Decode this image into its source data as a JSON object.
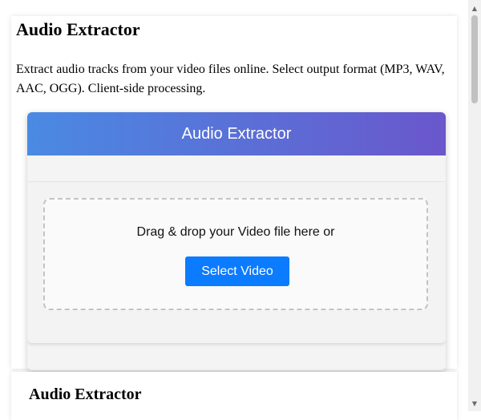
{
  "page": {
    "title": "Audio Extractor",
    "description": "Extract audio tracks from your video files online. Select output format (MP3, WAV, AAC, OGG). Client-side processing."
  },
  "tool": {
    "header_title": "Audio Extractor",
    "drop_text": "Drag & drop your Video file here or",
    "select_button_label": "Select Video",
    "accent_color": "#0b7bff",
    "header_gradient": [
      "#4a8ae3",
      "#6a57cc"
    ]
  },
  "next_section": {
    "title": "Audio Extractor"
  },
  "scrollbar": {
    "up_icon": "triangle-up-icon",
    "down_icon": "triangle-down-icon"
  }
}
